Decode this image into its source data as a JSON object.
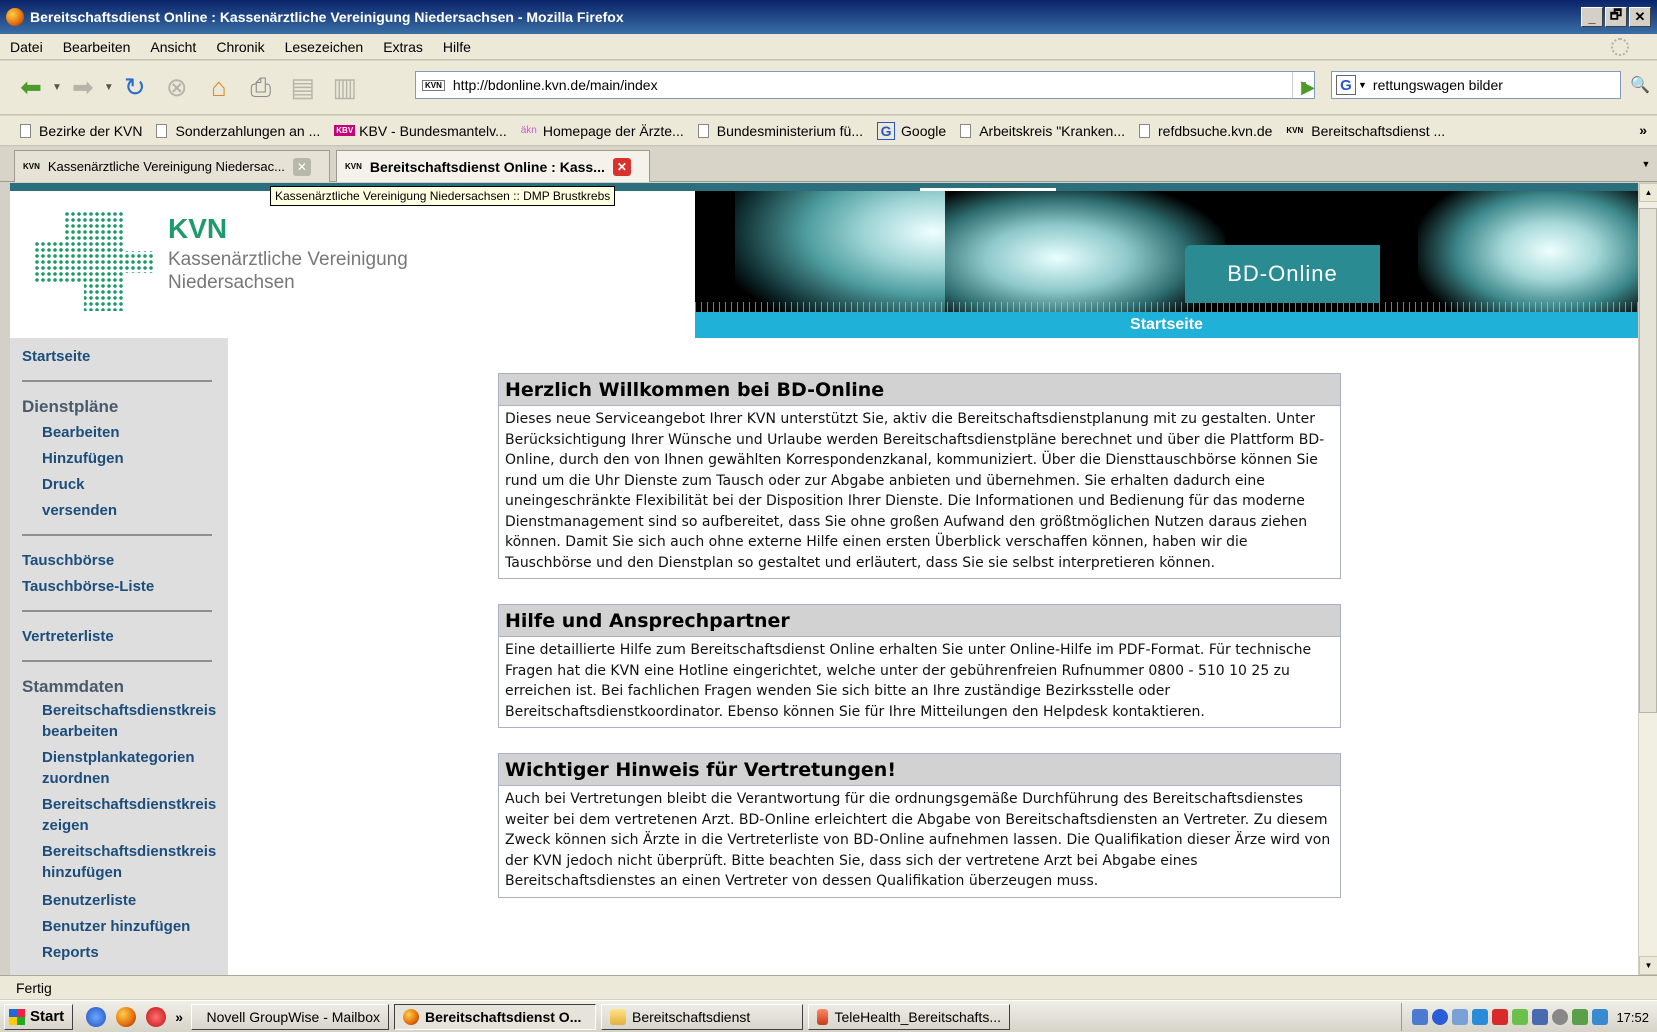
{
  "window": {
    "title": "Bereitschaftsdienst Online : Kassenärztliche Vereinigung Niedersachsen - Mozilla Firefox",
    "controls": [
      "_",
      "🗗",
      "✕"
    ]
  },
  "menu": [
    "Datei",
    "Bearbeiten",
    "Ansicht",
    "Chronik",
    "Lesezeichen",
    "Extras",
    "Hilfe"
  ],
  "nav": {
    "url": "http://bdonline.kvn.de/main/index",
    "search_value": "rettungswagen bilder",
    "url_favicon": "KVN"
  },
  "bookmarks": [
    {
      "label": "Bezirke der KVN",
      "icon": "page"
    },
    {
      "label": "Sonderzahlungen an ...",
      "icon": "page"
    },
    {
      "label": "KBV - Bundesmantelv...",
      "icon": "kbv",
      "icon_text": "KBV"
    },
    {
      "label": "Homepage der Ärzte...",
      "icon": "aekn",
      "icon_text": "äkn"
    },
    {
      "label": "Bundesministerium fü...",
      "icon": "page"
    },
    {
      "label": "Google",
      "icon": "google",
      "icon_text": "G"
    },
    {
      "label": "Arbeitskreis \"Kranken...",
      "icon": "page"
    },
    {
      "label": "refdbsuche.kvn.de",
      "icon": "page"
    },
    {
      "label": "Bereitschaftsdienst ...",
      "icon": "kvn",
      "icon_text": "KVN"
    }
  ],
  "bookmarks_more": "»",
  "tabs": [
    {
      "label": "Kassenärztliche Vereinigung Niedersac...",
      "active": false
    },
    {
      "label": "Bereitschaftsdienst Online : Kass...",
      "active": true
    }
  ],
  "tooltip": "Kassenärztliche Vereinigung Niedersachsen :: DMP Brustkrebs",
  "header": {
    "logo_name": "KVN",
    "logo_line1": "Kassenärztliche Vereinigung",
    "logo_line2": "Niedersachsen",
    "badge": "BD-Online",
    "page_label": "Startseite"
  },
  "sidebar": {
    "start": "Startseite",
    "dienstplaene": {
      "title": "Dienstpläne",
      "items": [
        "Bearbeiten",
        "Hinzufügen",
        "Druck",
        "versenden"
      ]
    },
    "tausch": [
      "Tauschbörse",
      "Tauschbörse-Liste"
    ],
    "vertreter": "Vertreterliste",
    "stammdaten": {
      "title": "Stammdaten",
      "items": [
        {
          "l1": "Bereitschaftsdienstkreis",
          "l2": "bearbeiten"
        },
        {
          "l1": "Dienstplankategorien",
          "l2": "zuordnen"
        },
        {
          "l1": "Bereitschaftsdienstkreis",
          "l2": "zeigen"
        },
        {
          "l1": "Bereitschaftsdienstkreis",
          "l2": "hinzufügen"
        }
      ],
      "simple": [
        "Benutzerliste",
        "Benutzer hinzufügen",
        "Reports"
      ]
    }
  },
  "content": [
    {
      "title": "Herzlich Willkommen bei BD-Online",
      "text": "Dieses neue Serviceangebot Ihrer KVN unterstützt Sie, aktiv die Bereitschaftsdienstplanung mit zu gestalten. Unter Berücksichtigung Ihrer Wünsche und Urlaube werden Bereitschaftsdienstpläne berechnet und über die Plattform BD-Online, durch den von Ihnen gewählten Korrespondenzkanal, kommuniziert. Über die Diensttauschbörse können Sie rund um die Uhr Dienste zum Tausch oder zur Abgabe anbieten und übernehmen. Sie erhalten dadurch eine uneingeschränkte Flexibilität bei der Disposition Ihrer Dienste. Die Informationen und Bedienung für das moderne Dienstmanagement sind so aufbereitet, dass Sie ohne großen Aufwand den größtmöglichen Nutzen daraus ziehen können. Damit Sie sich auch ohne externe Hilfe einen ersten Überblick verschaffen können, haben wir die Tauschbörse und den Dienstplan so gestaltet und erläutert, dass Sie sie selbst interpretieren können."
    },
    {
      "title": "Hilfe und Ansprechpartner",
      "text": "Eine detaillierte Hilfe zum Bereitschaftsdienst Online erhalten Sie unter Online-Hilfe im PDF-Format. Für technische Fragen hat die KVN eine Hotline eingerichtet, welche unter der gebührenfreien Rufnummer 0800 - 510 10 25 zu erreichen ist. Bei fachlichen Fragen wenden Sie sich bitte an Ihre zuständige Bezirksstelle oder Bereitschaftsdienstkoordinator. Ebenso können Sie für Ihre Mitteilungen den Helpdesk kontaktieren."
    },
    {
      "title": "Wichtiger Hinweis für Vertretungen!",
      "text": "Auch bei Vertretungen bleibt die Verantwortung für die ordnungsgemäße Durchführung des Bereitschaftsdienstes weiter bei dem vertretenen Arzt. BD-Online erleichtert die Abgabe von Bereitschaftsdiensten an Vertreter. Zu diesem Zweck können sich Ärzte in die Vertreterliste von BD-Online aufnehmen lassen. Die Qualifikation dieser Ärze wird von der KVN jedoch nicht überprüft. Bitte beachten Sie, dass sich der vertretene Arzt bei Abgabe eines Bereitschaftsdienstes an einen Vertreter von dessen Qualifikation überzeugen muss."
    }
  ],
  "status": "Fertig",
  "taskbar": {
    "start": "Start",
    "more": "»",
    "buttons": [
      {
        "label": "Novell GroupWise - Mailbox",
        "active": false
      },
      {
        "label": "Bereitschaftsdienst O...",
        "active": true
      },
      {
        "label": "Bereitschaftsdienst",
        "active": false
      },
      {
        "label": "TeleHealth_Bereitschafts...",
        "active": false
      }
    ],
    "clock": "17:52"
  }
}
